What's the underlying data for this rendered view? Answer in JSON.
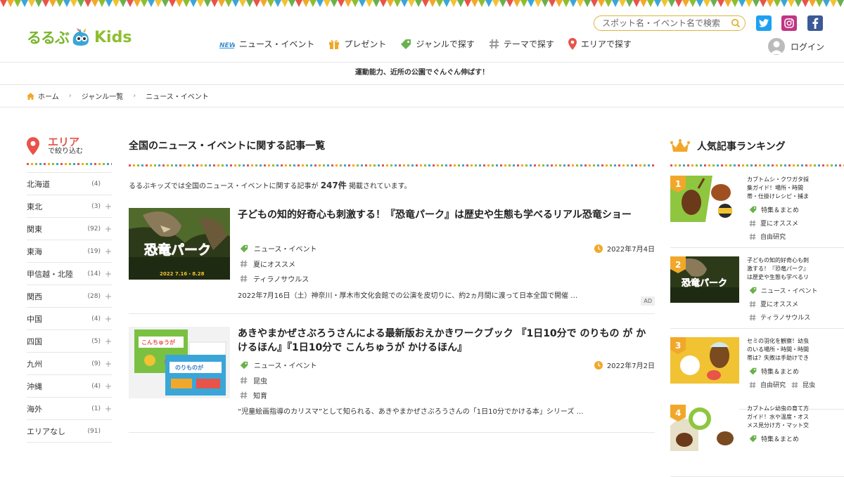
{
  "header": {
    "logo_text_1": "るるぶ",
    "logo_text_2": "Kids",
    "search_placeholder": "スポット名・イベント名で検索",
    "nav": [
      {
        "label": "ニュース・イベント",
        "icon": "news-icon"
      },
      {
        "label": "プレゼント",
        "icon": "gift-icon"
      },
      {
        "label": "ジャンルで探す",
        "icon": "tag-icon"
      },
      {
        "label": "テーマで探す",
        "icon": "hashtag-icon"
      },
      {
        "label": "エリアで探す",
        "icon": "pin-icon"
      }
    ],
    "login_label": "ログイン",
    "news_badge": "NEWS"
  },
  "promo": "運動能力、近所の公園でぐんぐん伸ばす！",
  "breadcrumb": [
    "ホーム",
    "ジャンル一覧",
    "ニュース・イベント"
  ],
  "sidebar": {
    "title": "エリア",
    "subtitle": "で絞り込む",
    "areas": [
      {
        "name": "北海道",
        "count": "(4)",
        "expand": ""
      },
      {
        "name": "東北",
        "count": "(3)",
        "expand": "+"
      },
      {
        "name": "関東",
        "count": "(92)",
        "expand": "+"
      },
      {
        "name": "東海",
        "count": "(19)",
        "expand": "+"
      },
      {
        "name": "甲信越・北陸",
        "count": "(14)",
        "expand": "+"
      },
      {
        "name": "関西",
        "count": "(28)",
        "expand": "+"
      },
      {
        "name": "中国",
        "count": "(4)",
        "expand": "+"
      },
      {
        "name": "四国",
        "count": "(5)",
        "expand": "+"
      },
      {
        "name": "九州",
        "count": "(9)",
        "expand": "+"
      },
      {
        "name": "沖縄",
        "count": "(4)",
        "expand": "+"
      },
      {
        "name": "海外",
        "count": "(1)",
        "expand": "+"
      },
      {
        "name": "エリアなし",
        "count": "(91)",
        "expand": ""
      }
    ]
  },
  "main": {
    "title": "全国のニュース・イベントに関する記事一覧",
    "count_prefix": "るるぶキッズでは全国のニュース・イベントに関する記事が",
    "count_value": "247件",
    "count_suffix": "掲載されています。",
    "articles": [
      {
        "title": "子どもの知的好奇心も刺激する！『恐竜パーク』は歴史や生態も学べるリアル恐竜ショー",
        "genre": "ニュース・イベント",
        "tags": [
          "夏にオススメ",
          "ティラノサウルス"
        ],
        "date": "2022年7月4日",
        "excerpt": "2022年7月16日（土）神奈川・厚木市文化会館での公演を皮切りに、約2ヵ月間に渡って日本全国で開催 …",
        "ad": "AD",
        "thumb_title": "恐竜パーク",
        "thumb_dates": "2022 7.16・8.28"
      },
      {
        "title": "あきやまかぜさぶろうさんによる最新版おえかきワークブック 『1日10分で のりもの が かけるほん』『1日10分で こんちゅうが かけるほん』",
        "genre": "ニュース・イベント",
        "tags": [
          "昆虫",
          "知育"
        ],
        "date": "2022年7月2日",
        "excerpt": "“児童絵画指導のカリスマ”として知られる、あきやまかぜさぶろうさんの「1日10分でかける本」シリーズ …",
        "thumb_title_1": "こんちゅうが",
        "thumb_title_2": "のりものが"
      }
    ]
  },
  "ranking": {
    "title": "人気記事ランキング",
    "items": [
      {
        "rank": "1",
        "title": "カブトムシ・クワガタ採集ガイド！場所・時間帯・仕掛けレシピ・捕まえ方・飼",
        "tags": [
          "特集＆まとめ",
          "夏にオススメ",
          "自由研究"
        ]
      },
      {
        "rank": "2",
        "title": "子どもの知的好奇心も刺激する！『恐竜パーク』は歴史や生態も学べるリアル恐",
        "tags": [
          "ニュース・イベント",
          "夏にオススメ",
          "ティラノサウルス"
        ]
      },
      {
        "rank": "3",
        "title": "セミの羽化を観察！幼虫のいる場所・時間・時間帯は？失敗は手助けできる？",
        "tags": [
          "特集＆まとめ",
          "自由研究",
          "昆虫"
        ]
      },
      {
        "rank": "4",
        "title": "カブトムシ幼虫の育て方ガイド！水や温度・オスメス見分け方・マット交換の時",
        "tags": [
          "特集＆まとめ"
        ]
      }
    ]
  },
  "colors": {
    "accent_green": "#6ab04c",
    "accent_red": "#e8534a",
    "accent_orange": "#f1a82a",
    "twitter": "#1da1f2",
    "facebook": "#3b5998"
  }
}
